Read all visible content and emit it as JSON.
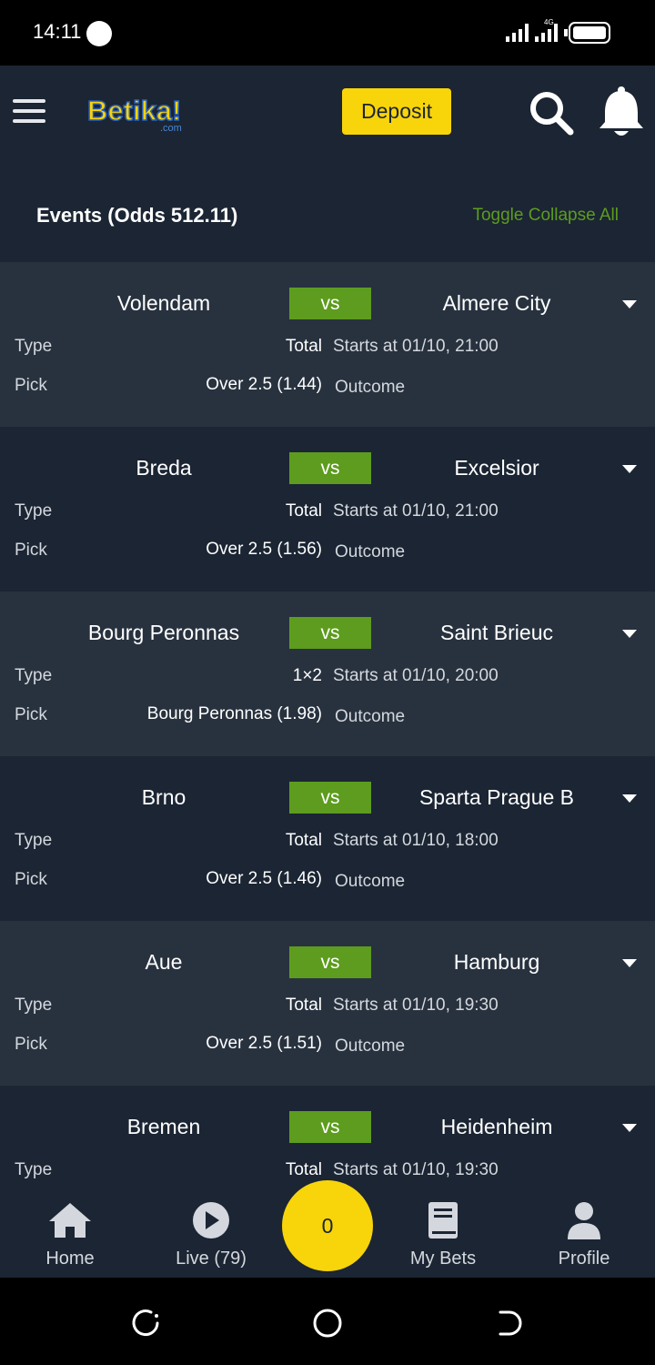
{
  "status_bar": {
    "time": "14:11",
    "network": "4G"
  },
  "header": {
    "logo_text": "Betika!",
    "logo_sub": ".com",
    "deposit_label": "Deposit"
  },
  "events_header": {
    "title": "Events (Odds 512.11)",
    "toggle_label": "Toggle Collapse All"
  },
  "labels": {
    "type": "Type",
    "pick": "Pick",
    "vs": "vs",
    "outcome": "Outcome"
  },
  "events": [
    {
      "home": "Volendam",
      "away": "Almere City",
      "type": "Total",
      "starts": "Starts at 01/10, 21:00",
      "pick": "Over 2.5 (1.44)"
    },
    {
      "home": "Breda",
      "away": "Excelsior",
      "type": "Total",
      "starts": "Starts at 01/10, 21:00",
      "pick": "Over 2.5 (1.56)"
    },
    {
      "home": "Bourg Peronnas",
      "away": "Saint Brieuc",
      "type": "1×2",
      "starts": "Starts at 01/10, 20:00",
      "pick": "Bourg Peronnas (1.98)"
    },
    {
      "home": "Brno",
      "away": "Sparta Prague B",
      "type": "Total",
      "starts": "Starts at 01/10, 18:00",
      "pick": "Over 2.5 (1.46)"
    },
    {
      "home": "Aue",
      "away": "Hamburg",
      "type": "Total",
      "starts": "Starts at 01/10, 19:30",
      "pick": "Over 2.5 (1.51)"
    },
    {
      "home": "Bremen",
      "away": "Heidenheim",
      "type": "Total",
      "starts": "Starts at 01/10, 19:30",
      "pick": ""
    }
  ],
  "bottom_nav": {
    "home": "Home",
    "live": "Live (79)",
    "betslip_count": "0",
    "my_bets": "My Bets",
    "profile": "Profile"
  },
  "colors": {
    "accent_yellow": "#f8d40b",
    "accent_green": "#5d9c1e",
    "bg_dark": "#1b2533",
    "bg_light": "#28323f"
  }
}
